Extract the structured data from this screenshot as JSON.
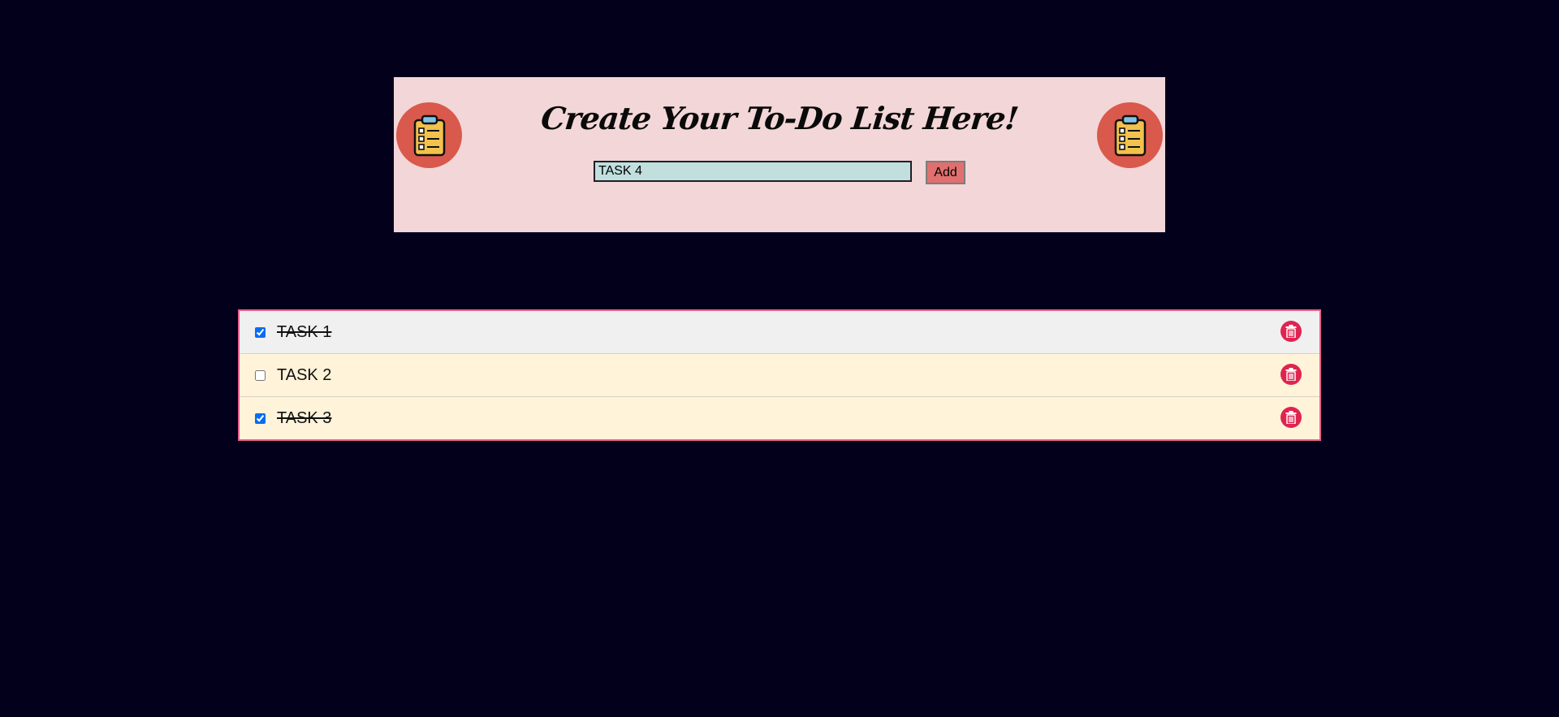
{
  "header": {
    "title": "Create Your To-Do List Here!",
    "input_value": "TASK 4",
    "add_label": "Add",
    "logo_icon": "clipboard-checklist-icon"
  },
  "tasks": [
    {
      "label": "TASK 1",
      "checked": true
    },
    {
      "label": "TASK 2",
      "checked": false
    },
    {
      "label": "TASK 3",
      "checked": true
    }
  ],
  "colors": {
    "background": "#03001c",
    "header_card": "#f3d6d7",
    "logo_circle": "#d9594c",
    "input_bg": "#c0dfdd",
    "add_button": "#e0706f",
    "list_border": "#e8608a",
    "list_bg": "#fff3d9",
    "delete_button": "#e0234f"
  },
  "icons": {
    "delete": "trash-icon"
  }
}
